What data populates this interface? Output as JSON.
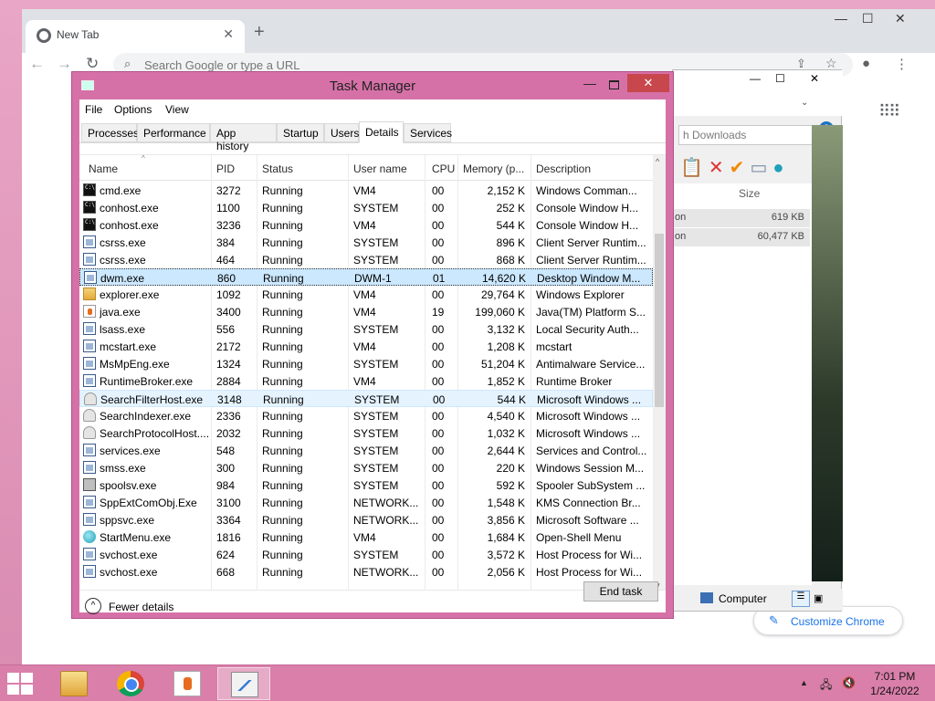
{
  "chrome": {
    "tab_title": "New Tab",
    "omnibox_placeholder": "Search Google or type a URL",
    "customize_label": "Customize Chrome"
  },
  "explorer": {
    "search_placeholder": "h Downloads",
    "size_header": "Size",
    "rows": [
      {
        "name": "on",
        "size": "619 KB"
      },
      {
        "name": "on",
        "size": "60,477 KB"
      }
    ],
    "status_item": "Computer"
  },
  "taskmanager": {
    "title": "Task Manager",
    "menu": [
      "File",
      "Options",
      "View"
    ],
    "tabs": [
      "Processes",
      "Performance",
      "App history",
      "Startup",
      "Users",
      "Details",
      "Services"
    ],
    "active_tab": "Details",
    "columns": [
      "Name",
      "PID",
      "Status",
      "User name",
      "CPU",
      "Memory (p...",
      "Description"
    ],
    "rows": [
      {
        "name": "cmd.exe",
        "pid": "3272",
        "status": "Running",
        "user": "VM4",
        "cpu": "00",
        "mem": "2,152 K",
        "desc": "Windows Comman...",
        "icon": "cmd"
      },
      {
        "name": "conhost.exe",
        "pid": "1100",
        "status": "Running",
        "user": "SYSTEM",
        "cpu": "00",
        "mem": "252 K",
        "desc": "Console Window H...",
        "icon": "cmd"
      },
      {
        "name": "conhost.exe",
        "pid": "3236",
        "status": "Running",
        "user": "VM4",
        "cpu": "00",
        "mem": "544 K",
        "desc": "Console Window H...",
        "icon": "cmd"
      },
      {
        "name": "csrss.exe",
        "pid": "384",
        "status": "Running",
        "user": "SYSTEM",
        "cpu": "00",
        "mem": "896 K",
        "desc": "Client Server Runtim...",
        "icon": "win"
      },
      {
        "name": "csrss.exe",
        "pid": "464",
        "status": "Running",
        "user": "SYSTEM",
        "cpu": "00",
        "mem": "868 K",
        "desc": "Client Server Runtim...",
        "icon": "win"
      },
      {
        "name": "dwm.exe",
        "pid": "860",
        "status": "Running",
        "user": "DWM-1",
        "cpu": "01",
        "mem": "14,620 K",
        "desc": "Desktop Window M...",
        "icon": "win",
        "state": "sel"
      },
      {
        "name": "explorer.exe",
        "pid": "1092",
        "status": "Running",
        "user": "VM4",
        "cpu": "00",
        "mem": "29,764 K",
        "desc": "Windows Explorer",
        "icon": "folder"
      },
      {
        "name": "java.exe",
        "pid": "3400",
        "status": "Running",
        "user": "VM4",
        "cpu": "19",
        "mem": "199,060 K",
        "desc": "Java(TM) Platform S...",
        "icon": "java"
      },
      {
        "name": "lsass.exe",
        "pid": "556",
        "status": "Running",
        "user": "SYSTEM",
        "cpu": "00",
        "mem": "3,132 K",
        "desc": "Local Security Auth...",
        "icon": "win"
      },
      {
        "name": "mcstart.exe",
        "pid": "2172",
        "status": "Running",
        "user": "VM4",
        "cpu": "00",
        "mem": "1,208 K",
        "desc": "mcstart",
        "icon": "win"
      },
      {
        "name": "MsMpEng.exe",
        "pid": "1324",
        "status": "Running",
        "user": "SYSTEM",
        "cpu": "00",
        "mem": "51,204 K",
        "desc": "Antimalware Service...",
        "icon": "win"
      },
      {
        "name": "RuntimeBroker.exe",
        "pid": "2884",
        "status": "Running",
        "user": "VM4",
        "cpu": "00",
        "mem": "1,852 K",
        "desc": "Runtime Broker",
        "icon": "win"
      },
      {
        "name": "SearchFilterHost.exe",
        "pid": "3148",
        "status": "Running",
        "user": "SYSTEM",
        "cpu": "00",
        "mem": "544 K",
        "desc": "Microsoft Windows ...",
        "icon": "user",
        "state": "hov"
      },
      {
        "name": "SearchIndexer.exe",
        "pid": "2336",
        "status": "Running",
        "user": "SYSTEM",
        "cpu": "00",
        "mem": "4,540 K",
        "desc": "Microsoft Windows ...",
        "icon": "user"
      },
      {
        "name": "SearchProtocolHost....",
        "pid": "2032",
        "status": "Running",
        "user": "SYSTEM",
        "cpu": "00",
        "mem": "1,032 K",
        "desc": "Microsoft Windows ...",
        "icon": "user"
      },
      {
        "name": "services.exe",
        "pid": "548",
        "status": "Running",
        "user": "SYSTEM",
        "cpu": "00",
        "mem": "2,644 K",
        "desc": "Services and Control...",
        "icon": "win"
      },
      {
        "name": "smss.exe",
        "pid": "300",
        "status": "Running",
        "user": "SYSTEM",
        "cpu": "00",
        "mem": "220 K",
        "desc": "Windows Session M...",
        "icon": "win"
      },
      {
        "name": "spoolsv.exe",
        "pid": "984",
        "status": "Running",
        "user": "SYSTEM",
        "cpu": "00",
        "mem": "592 K",
        "desc": "Spooler SubSystem ...",
        "icon": "printer"
      },
      {
        "name": "SppExtComObj.Exe",
        "pid": "3100",
        "status": "Running",
        "user": "NETWORK...",
        "cpu": "00",
        "mem": "1,548 K",
        "desc": "KMS Connection Br...",
        "icon": "win"
      },
      {
        "name": "sppsvc.exe",
        "pid": "3364",
        "status": "Running",
        "user": "NETWORK...",
        "cpu": "00",
        "mem": "3,856 K",
        "desc": "Microsoft Software ...",
        "icon": "win"
      },
      {
        "name": "StartMenu.exe",
        "pid": "1816",
        "status": "Running",
        "user": "VM4",
        "cpu": "00",
        "mem": "1,684 K",
        "desc": "Open-Shell Menu",
        "icon": "shell"
      },
      {
        "name": "svchost.exe",
        "pid": "624",
        "status": "Running",
        "user": "SYSTEM",
        "cpu": "00",
        "mem": "3,572 K",
        "desc": "Host Process for Wi...",
        "icon": "win"
      },
      {
        "name": "svchost.exe",
        "pid": "668",
        "status": "Running",
        "user": "NETWORK...",
        "cpu": "00",
        "mem": "2,056 K",
        "desc": "Host Process for Wi...",
        "icon": "win"
      }
    ],
    "fewer_details": "Fewer details",
    "end_task": "End task"
  },
  "taskbar": {
    "time": "7:01 PM",
    "date": "1/24/2022"
  }
}
